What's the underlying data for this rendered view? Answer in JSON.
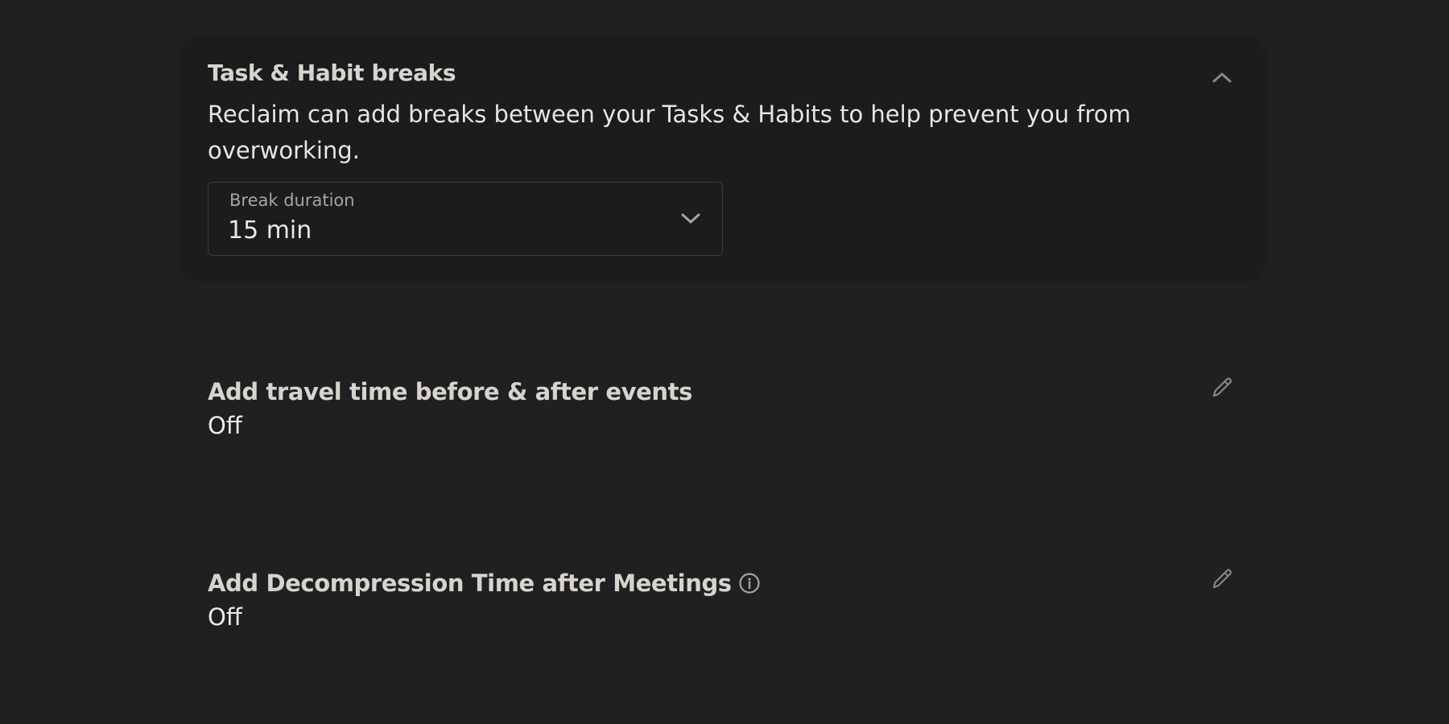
{
  "breaks_card": {
    "title": "Task & Habit breaks",
    "description": "Reclaim can add breaks between your Tasks & Habits to help prevent you from overworking.",
    "break_duration": {
      "label": "Break duration",
      "value": "15 min"
    },
    "collapse_icon": "chevron-up-icon"
  },
  "settings": [
    {
      "title": "Add travel time before & after events",
      "value": "Off",
      "edit_icon": "pencil-icon"
    },
    {
      "title": "Add Decompression Time after Meetings",
      "value": "Off",
      "info_icon": "info-icon",
      "edit_icon": "pencil-icon"
    }
  ],
  "colors": {
    "background": "#1f2022",
    "card": "#1b1c1e",
    "heading": "#d8d4cd",
    "text": "#e8e5e1",
    "muted": "#a8a49d",
    "icon": "#8a8782"
  }
}
